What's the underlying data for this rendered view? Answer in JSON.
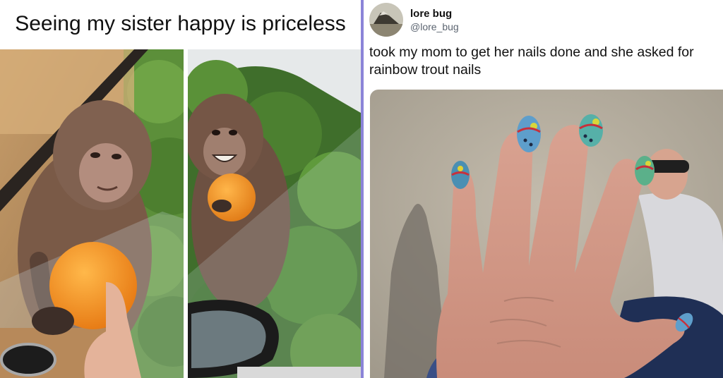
{
  "left_meme": {
    "caption": "Seeing my sister happy is priceless",
    "photos": [
      "macaque-reaching-orange",
      "macaque-smiling-with-orange"
    ]
  },
  "tweet": {
    "display_name": "lore bug",
    "handle": "@lore_bug",
    "text": "took my mom to get her nails done and she asked for rainbow trout nails",
    "photo": "hand-with-rainbow-trout-nails"
  },
  "colors": {
    "divider": "#8b84d8",
    "orange": "#f7941d",
    "foliage": "#4f8a33"
  }
}
